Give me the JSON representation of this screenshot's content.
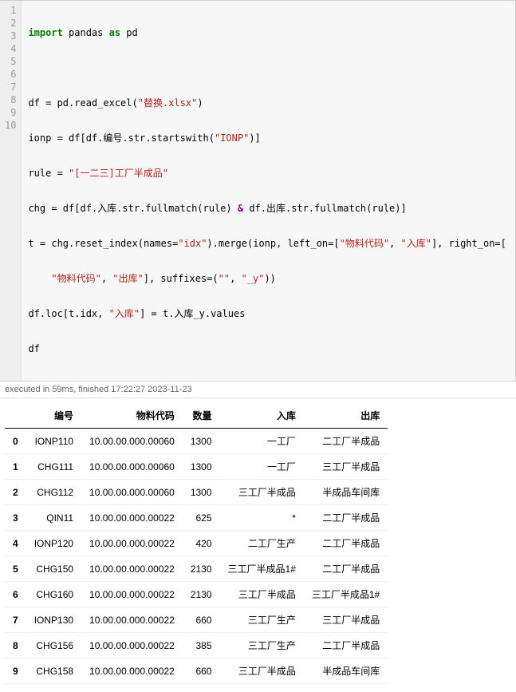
{
  "code": {
    "lines": {
      "l1_import": "import",
      "l1_rest": " pandas ",
      "l1_as": "as",
      "l1_pd": " pd",
      "l2": "",
      "l3_a": "df = pd.read_excel(",
      "l3_str": "\"替换.xlsx\"",
      "l3_b": ")",
      "l4_a": "ionp = df[df.编号.str.startswith(",
      "l4_str": "\"IONP\"",
      "l4_b": ")]",
      "l5_a": "rule = ",
      "l5_str": "\"[一二三]工厂半成品\"",
      "l6_a": "chg = df[df.入库.str.fullmatch(rule) ",
      "l6_amp": "&",
      "l6_b": " df.出库.str.fullmatch(rule)]",
      "l7_a": "t = chg.reset_index(names=",
      "l7_s1": "\"idx\"",
      "l7_b": ").merge(ionp, left_on=[",
      "l7_s2": "\"物料代码\"",
      "l7_c": ", ",
      "l7_s3": "\"入库\"",
      "l7_d": "], right_on=[",
      "l8_a": "    ",
      "l8_s1": "\"物料代码\"",
      "l8_b": ", ",
      "l8_s2": "\"出库\"",
      "l8_c": "], suffixes=(",
      "l8_s3": "\"\"",
      "l8_d": ", ",
      "l8_s4": "\"_y\"",
      "l8_e": "))",
      "l9_a": "df.loc[t.idx, ",
      "l9_s1": "\"入库\"",
      "l9_b": "] = t.入库_y.values",
      "l10": "df"
    },
    "gutter": [
      "1",
      "2",
      "3",
      "4",
      "5",
      "6",
      "7",
      "8",
      "9",
      "10"
    ]
  },
  "status": "executed in 59ms, finished 17:22:27 2023-11-23",
  "table": {
    "columns": [
      "编号",
      "物料代码",
      "数量",
      "入库",
      "出库"
    ],
    "rows": [
      {
        "idx": "0",
        "c0": "IONP110",
        "c1": "10.00.00.000.00060",
        "c2": "1300",
        "c3": "一工厂",
        "c4": "二工厂半成品"
      },
      {
        "idx": "1",
        "c0": "CHG111",
        "c1": "10.00.00.000.00060",
        "c2": "1300",
        "c3": "一工厂",
        "c4": "三工厂半成品"
      },
      {
        "idx": "2",
        "c0": "CHG112",
        "c1": "10.00.00.000.00060",
        "c2": "1300",
        "c3": "三工厂半成品",
        "c4": "半成品车间库"
      },
      {
        "idx": "3",
        "c0": "QIN11",
        "c1": "10.00.00.000.00022",
        "c2": "625",
        "c3": "*",
        "c4": "二工厂半成品"
      },
      {
        "idx": "4",
        "c0": "IONP120",
        "c1": "10.00.00.000.00022",
        "c2": "420",
        "c3": "二工厂生产",
        "c4": "二工厂半成品"
      },
      {
        "idx": "5",
        "c0": "CHG150",
        "c1": "10.00.00.000.00022",
        "c2": "2130",
        "c3": "三工厂半成品1#",
        "c4": "二工厂半成品"
      },
      {
        "idx": "6",
        "c0": "CHG160",
        "c1": "10.00.00.000.00022",
        "c2": "2130",
        "c3": "三工厂半成品",
        "c4": "三工厂半成品1#"
      },
      {
        "idx": "7",
        "c0": "IONP130",
        "c1": "10.00.00.000.00022",
        "c2": "660",
        "c3": "三工厂生产",
        "c4": "三工厂半成品"
      },
      {
        "idx": "8",
        "c0": "CHG156",
        "c1": "10.00.00.000.00022",
        "c2": "385",
        "c3": "三工厂生产",
        "c4": "二工厂半成品"
      },
      {
        "idx": "9",
        "c0": "CHG158",
        "c1": "10.00.00.000.00022",
        "c2": "660",
        "c3": "三工厂半成品",
        "c4": "半成品车间库"
      }
    ]
  }
}
